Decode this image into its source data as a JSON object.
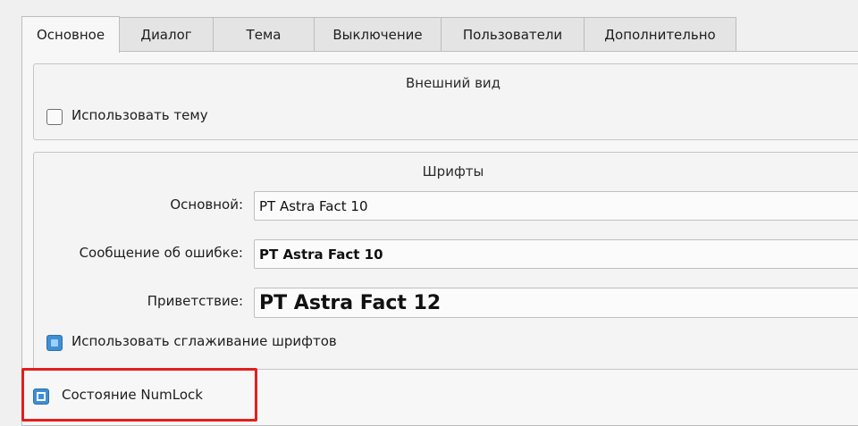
{
  "tabs": [
    {
      "label": "Основное",
      "active": true
    },
    {
      "label": "Диалог",
      "active": false
    },
    {
      "label": "Тема",
      "active": false
    },
    {
      "label": "Выключение",
      "active": false
    },
    {
      "label": "Пользователи",
      "active": false
    },
    {
      "label": "Дополнительно",
      "active": false
    }
  ],
  "appearance": {
    "title": "Внешний вид",
    "use_theme_label": "Использовать тему",
    "use_theme_checked": false
  },
  "fonts": {
    "title": "Шрифты",
    "rows": [
      {
        "label": "Основной:",
        "value": "PT Astra Fact 10"
      },
      {
        "label": "Сообщение об ошибке:",
        "value": "PT Astra Fact 10"
      },
      {
        "label": "Приветствие:",
        "value": "PT Astra Fact 12"
      }
    ],
    "antialias_label": "Использовать сглаживание шрифтов",
    "antialias_checked": true
  },
  "numlock": {
    "label": "Состояние NumLock",
    "state": "partial"
  },
  "colors": {
    "accent": "#3d8fd6",
    "highlight": "#e0201e"
  }
}
